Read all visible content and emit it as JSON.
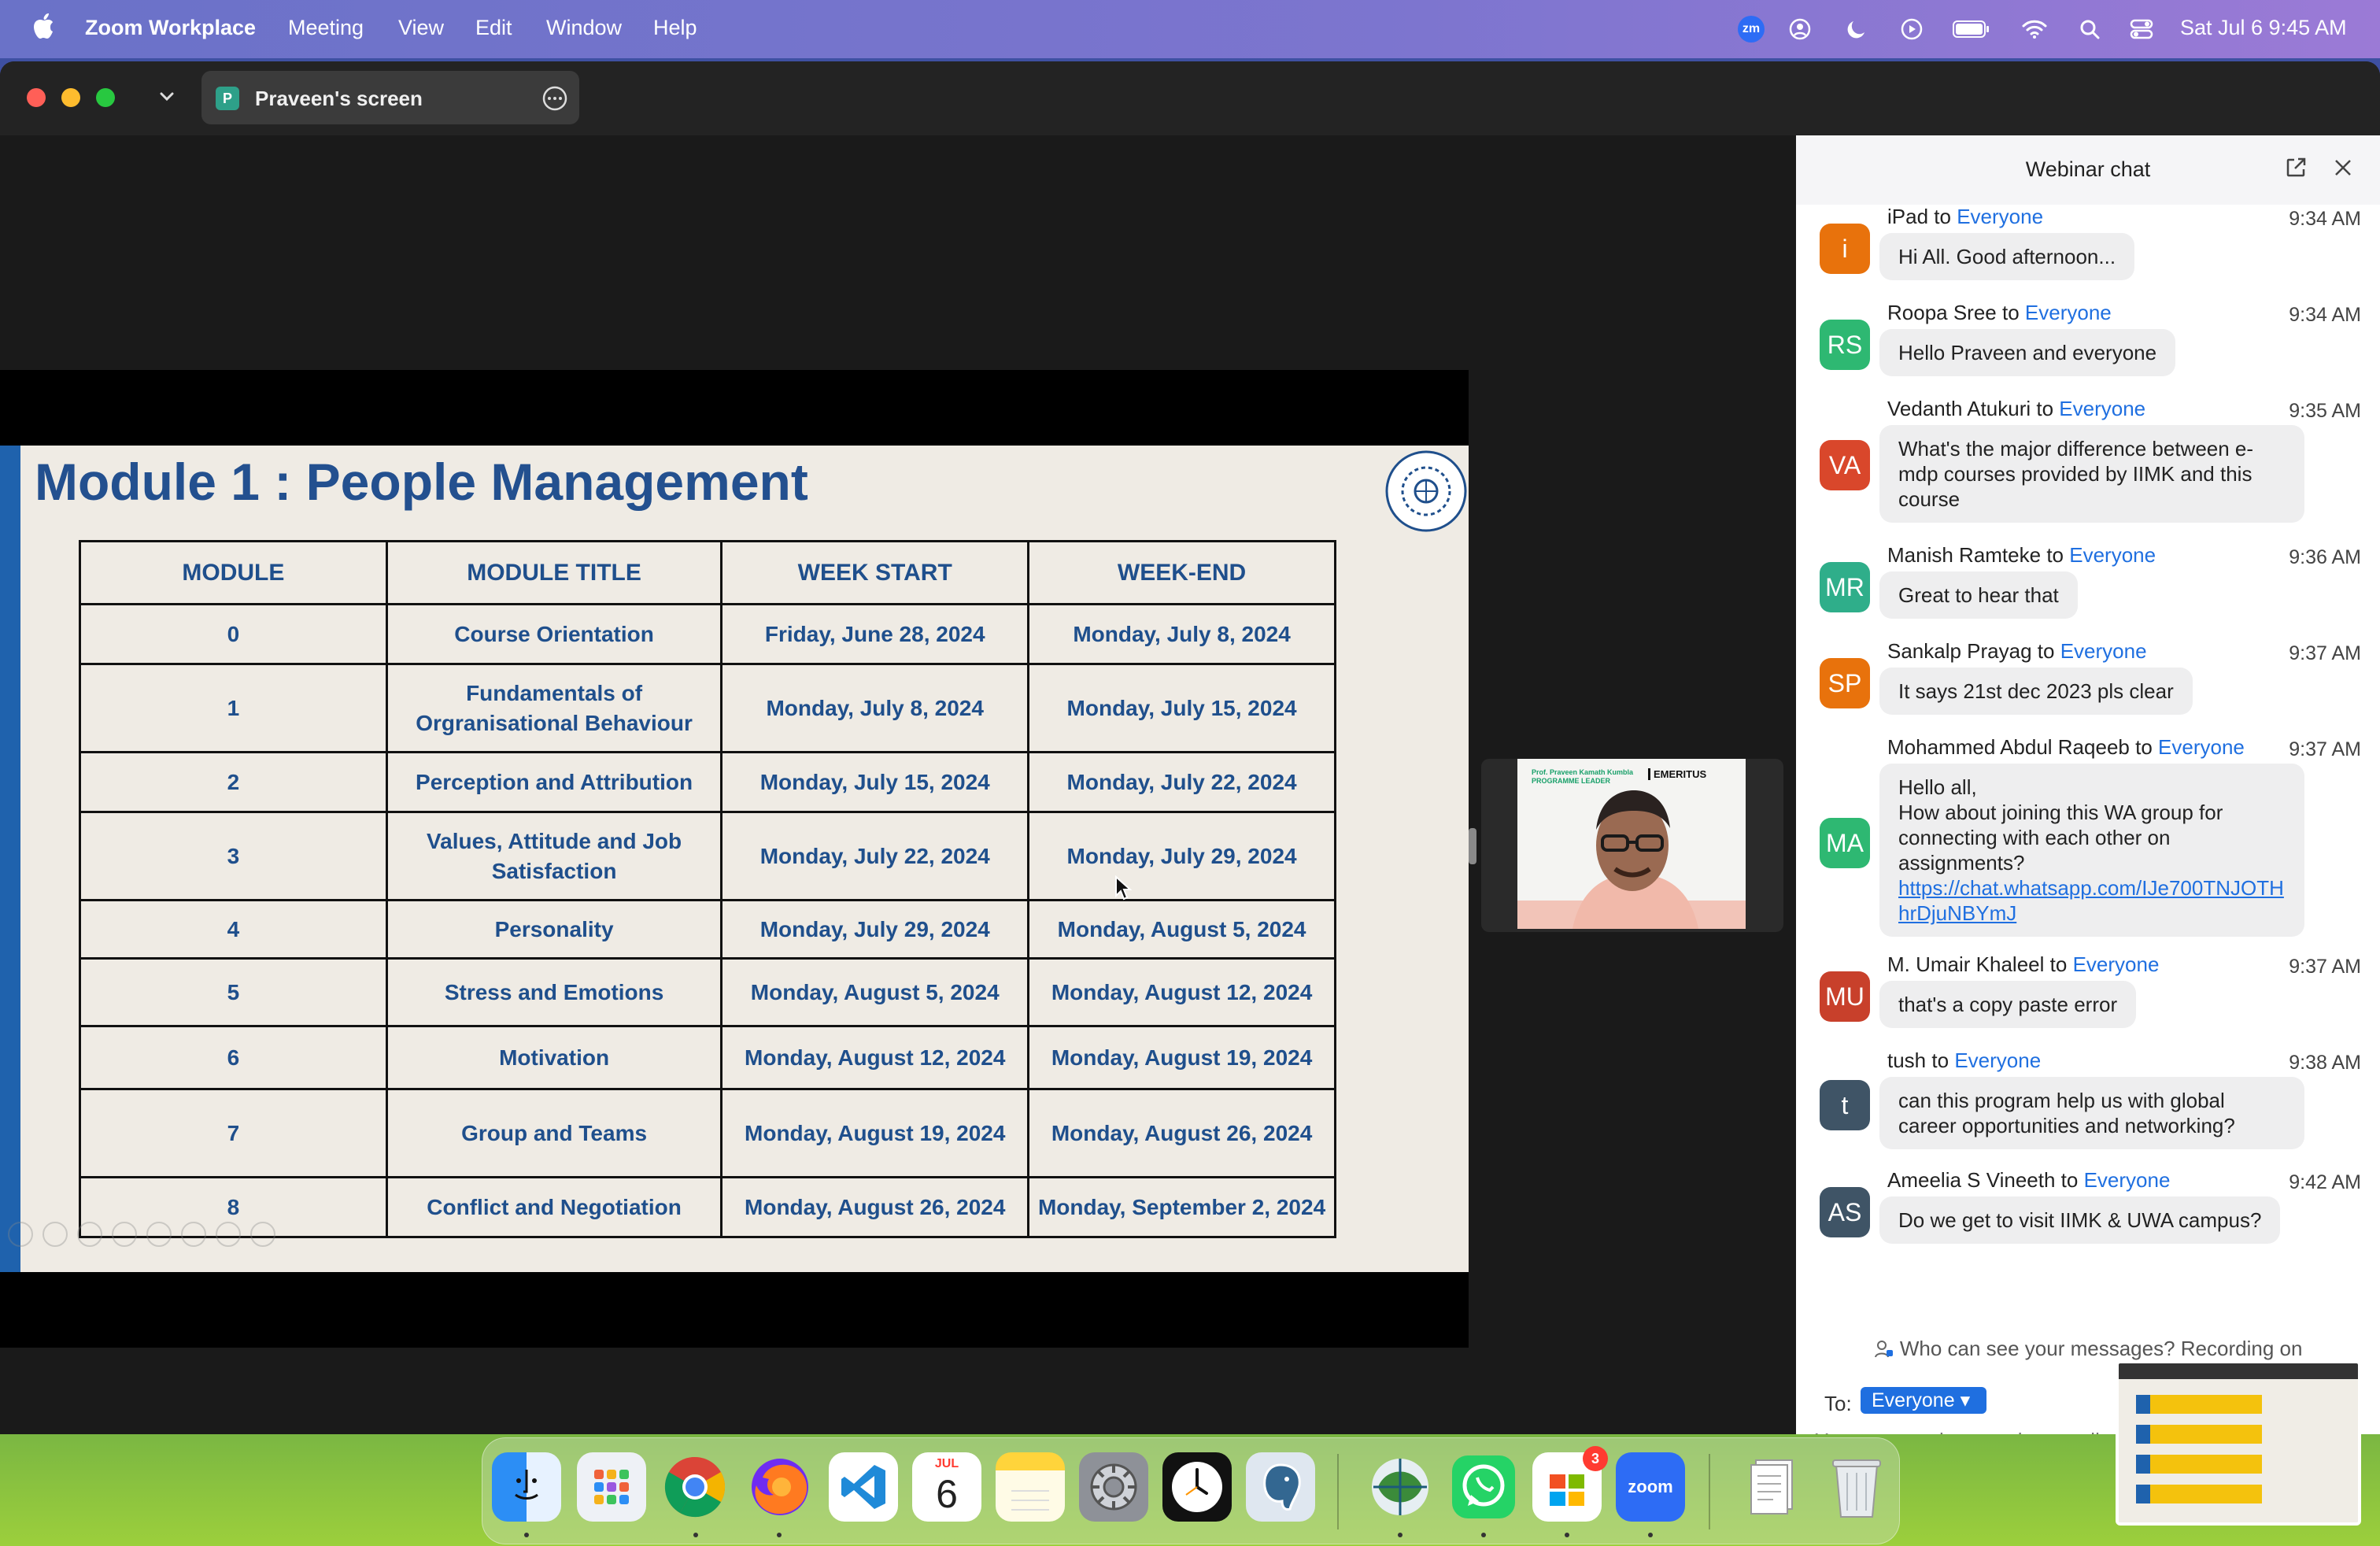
{
  "menubar": {
    "app_name": "Zoom Workplace",
    "items": [
      "Meeting",
      "View",
      "Edit",
      "Window",
      "Help"
    ],
    "zm_label": "zm",
    "datetime": "Sat Jul 6  9:45 AM"
  },
  "window": {
    "tab_avatar": "P",
    "tab_label": "Praveen's screen"
  },
  "slide": {
    "title": "Module 1 : People Management",
    "columns": [
      "MODULE",
      "MODULE TITLE",
      "WEEK START",
      "WEEK-END"
    ],
    "rows": [
      [
        "0",
        "Course Orientation",
        "Friday, June 28, 2024",
        "Monday, July 8, 2024"
      ],
      [
        "1",
        "Fundamentals of Orgranisational Behaviour",
        "Monday, July 8, 2024",
        "Monday, July 15, 2024"
      ],
      [
        "2",
        "Perception and Attribution",
        "Monday, July 15, 2024",
        "Monday, July 22, 2024"
      ],
      [
        "3",
        "Values, Attitude and Job Satisfaction",
        "Monday, July 22, 2024",
        "Monday, July 29, 2024"
      ],
      [
        "4",
        "Personality",
        "Monday, July 29, 2024",
        "Monday, August 5, 2024"
      ],
      [
        "5",
        "Stress and Emotions",
        "Monday, August 5, 2024",
        "Monday, August 12, 2024"
      ],
      [
        "6",
        "Motivation",
        "Monday, August 12, 2024",
        "Monday, August 19, 2024"
      ],
      [
        "7",
        "Group and Teams",
        "Monday, August 19, 2024",
        "Monday, August 26, 2024"
      ],
      [
        "8",
        "Conflict and Negotiation",
        "Monday, August 26, 2024",
        "Monday, September 2, 2024"
      ]
    ]
  },
  "video": {
    "caption": "Prof. Praveen Kamath Kumbla PROGRAMME LEADER",
    "brand": "EMERITUS"
  },
  "chat": {
    "title": "Webinar chat",
    "to_word": "to",
    "messages": [
      {
        "initials": "i",
        "color": "#e8720c",
        "sender": "iPad",
        "audience": "Everyone",
        "time": "9:34 AM",
        "text": "Hi All. Good afternoon..."
      },
      {
        "initials": "RS",
        "color": "#2eb872",
        "sender": "Roopa Sree",
        "audience": "Everyone",
        "time": "9:34 AM",
        "text": "Hello Praveen and everyone"
      },
      {
        "initials": "VA",
        "color": "#d9472b",
        "sender": "Vedanth Atukuri",
        "audience": "Everyone",
        "time": "9:35 AM",
        "text": "What's the major difference between e-mdp courses provided by IIMK and this course"
      },
      {
        "initials": "MR",
        "color": "#2fae8a",
        "sender": "Manish Ramteke",
        "audience": "Everyone",
        "time": "9:36 AM",
        "text": "Great to hear that"
      },
      {
        "initials": "SP",
        "color": "#e8720c",
        "sender": "Sankalp Prayag",
        "audience": "Everyone",
        "time": "9:37 AM",
        "text": "It says 21st dec 2023 pls clear"
      },
      {
        "initials": "MA",
        "color": "#2eb872",
        "sender": "Mohammed Abdul Raqeeb",
        "audience": "Everyone",
        "time": "9:37 AM",
        "text": "Hello all,\nHow about joining this WA group for connecting with each other on assignments?",
        "link": "https://chat.whatsapp.com/IJe700TNJOTHhrDjuNBYmJ"
      },
      {
        "initials": "MU",
        "color": "#c8402b",
        "sender": "M. Umair Khaleel",
        "audience": "Everyone",
        "time": "9:37 AM",
        "text": "that's a copy paste error"
      },
      {
        "initials": "t",
        "color": "#3f5466",
        "sender": "tush",
        "audience": "Everyone",
        "time": "9:38 AM",
        "text": "can this program help us with global career opportunities and networking?"
      },
      {
        "initials": "AS",
        "color": "#3f5466",
        "sender": "Ameelia S Vineeth",
        "audience": "Everyone",
        "time": "9:42 AM",
        "text": "Do we get to visit IIMK & UWA campus?"
      }
    ],
    "notice": "Who can see your messages? Recording on",
    "to_label": "To:",
    "to_value": "Everyone",
    "input_placeholder": "Your text can be seen by panelists and attendees"
  },
  "dock": {
    "calendar_month": "JUL",
    "calendar_day": "6",
    "zoom_label": "zoom",
    "notification_badge": "3"
  }
}
